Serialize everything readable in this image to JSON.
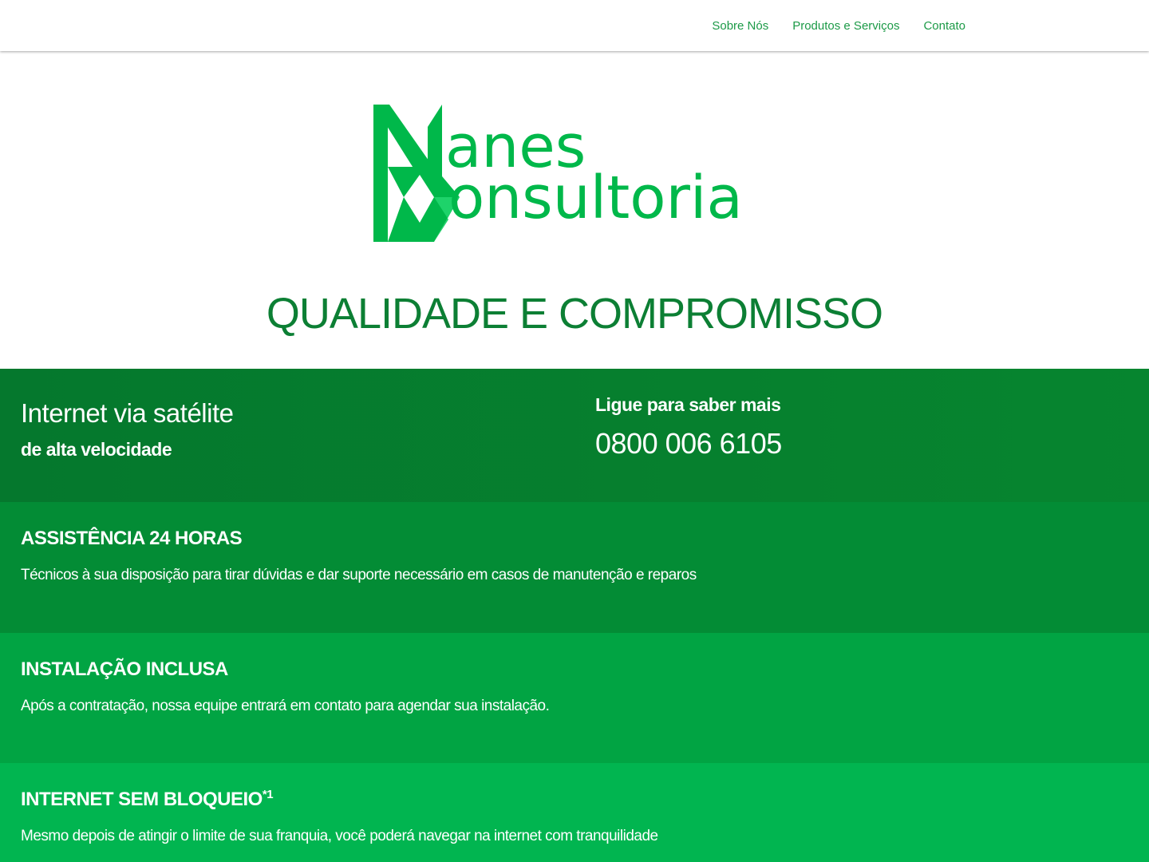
{
  "nav": {
    "items": [
      "Sobre Nós",
      "Produtos e Serviços",
      "Contato"
    ]
  },
  "logo": {
    "text_line1": "anes",
    "text_line2": "onsultoria",
    "color": "#00b84a"
  },
  "hero": {
    "tagline": "QUALIDADE E COMPROMISSO"
  },
  "cta": {
    "title": "Internet via satélite",
    "subtitle": "de alta velocidade",
    "call_label": "Ligue para saber mais",
    "phone": "0800 006 6105"
  },
  "features": [
    {
      "title": "ASSISTÊNCIA 24 HORAS",
      "sup": "",
      "text": "Técnicos à sua disposição para tirar dúvidas e dar suporte necessário em casos de manutenção e reparos"
    },
    {
      "title": "INSTALAÇÃO INCLUSA",
      "sup": "",
      "text": "Após a contratação, nossa equipe entrará em contato para agendar sua instalação."
    },
    {
      "title": "INTERNET SEM BLOQUEIO",
      "sup": "*1",
      "text": "Mesmo depois de atingir o limite de sua franquia, você poderá navegar na internet com tranquilidade"
    }
  ],
  "colors": {
    "nav_link": "#1c9a47",
    "tagline": "#0c7f34",
    "band_cta": "#05782d",
    "band_1": "#038c35",
    "band_2": "#01a443",
    "band_3": "#01b550"
  }
}
